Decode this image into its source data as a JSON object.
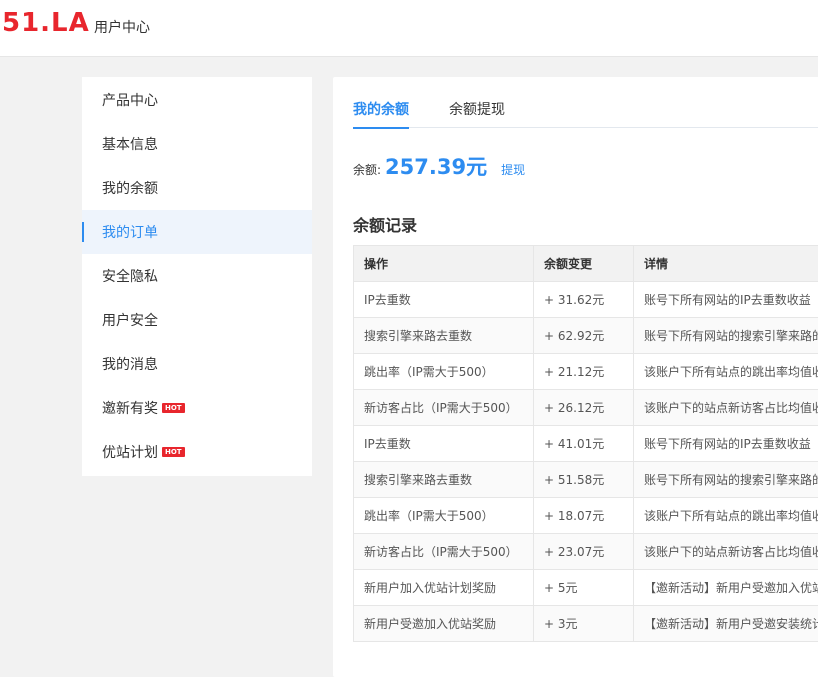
{
  "header": {
    "logo": "51.LA",
    "title": "用户中心"
  },
  "sidebar": {
    "items": [
      {
        "label": "产品中心",
        "hot": false,
        "active": false
      },
      {
        "label": "基本信息",
        "hot": false,
        "active": false
      },
      {
        "label": "我的余额",
        "hot": false,
        "active": false
      },
      {
        "label": "我的订单",
        "hot": false,
        "active": true
      },
      {
        "label": "安全隐私",
        "hot": false,
        "active": false
      },
      {
        "label": "用户安全",
        "hot": false,
        "active": false
      },
      {
        "label": "我的消息",
        "hot": false,
        "active": false
      },
      {
        "label": "邀新有奖",
        "hot": true,
        "active": false
      },
      {
        "label": "优站计划",
        "hot": true,
        "active": false
      }
    ],
    "hot_label": "HOT"
  },
  "tabs": [
    {
      "label": "我的余额",
      "active": true
    },
    {
      "label": "余额提现",
      "active": false
    }
  ],
  "balance": {
    "label": "余额:",
    "value": "257.39元",
    "withdraw": "提现"
  },
  "records": {
    "title": "余额记录",
    "columns": [
      "操作",
      "余额变更",
      "详情"
    ],
    "rows": [
      [
        "IP去重数",
        "+ 31.62元",
        "账号下所有网站的IP去重数收益"
      ],
      [
        "搜索引擎来路去重数",
        "+ 62.92元",
        "账号下所有网站的搜索引擎来路的"
      ],
      [
        "跳出率（IP需大于500）",
        "+ 21.12元",
        "该账户下所有站点的跳出率均值收"
      ],
      [
        "新访客占比（IP需大于500）",
        "+ 26.12元",
        "该账户下的站点新访客占比均值收"
      ],
      [
        "IP去重数",
        "+ 41.01元",
        "账号下所有网站的IP去重数收益"
      ],
      [
        "搜索引擎来路去重数",
        "+ 51.58元",
        "账号下所有网站的搜索引擎来路的"
      ],
      [
        "跳出率（IP需大于500）",
        "+ 18.07元",
        "该账户下所有站点的跳出率均值收"
      ],
      [
        "新访客占比（IP需大于500）",
        "+ 23.07元",
        "该账户下的站点新访客占比均值收"
      ],
      [
        "新用户加入优站计划奖励",
        "+ 5元",
        "【邀新活动】新用户受邀加入优站"
      ],
      [
        "新用户受邀加入优站奖励",
        "+ 3元",
        "【邀新活动】新用户受邀安装统计"
      ]
    ]
  }
}
